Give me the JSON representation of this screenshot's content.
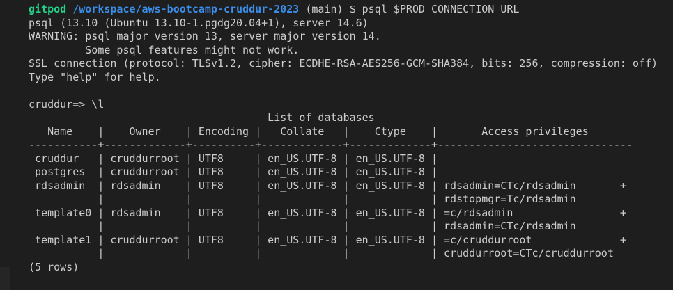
{
  "terminal": {
    "prompt": {
      "user": "gitpod",
      "path": "/workspace/aws-bootcamp-cruddur-2023",
      "branch": "(main)",
      "symbol": "$",
      "command": "psql $PROD_CONNECTION_URL"
    },
    "output_lines": [
      "psql (13.10 (Ubuntu 13.10-1.pgdg20.04+1), server 14.6)",
      "WARNING: psql major version 13, server major version 14.",
      "         Some psql features might not work.",
      "SSL connection (protocol: TLSv1.2, cipher: ECDHE-RSA-AES256-GCM-SHA384, bits: 256, compression: off)",
      "Type \"help\" for help.",
      "",
      "cruddur=> \\l",
      "                                      List of databases",
      "   Name    |    Owner    | Encoding |   Collate   |    Ctype    |       Access privileges",
      "-----------+-------------+----------+-------------+-------------+-------------------------------",
      " cruddur   | cruddurroot | UTF8     | en_US.UTF-8 | en_US.UTF-8 | ",
      " postgres  | cruddurroot | UTF8     | en_US.UTF-8 | en_US.UTF-8 | ",
      " rdsadmin  | rdsadmin    | UTF8     | en_US.UTF-8 | en_US.UTF-8 | rdsadmin=CTc/rdsadmin       +",
      "           |             |          |             |             | rdstopmgr=Tc/rdsadmin",
      " template0 | rdsadmin    | UTF8     | en_US.UTF-8 | en_US.UTF-8 | =c/rdsadmin                 +",
      "           |             |          |             |             | rdsadmin=CTc/rdsadmin",
      " template1 | cruddurroot | UTF8     | en_US.UTF-8 | en_US.UTF-8 | =c/cruddurroot              +",
      "           |             |          |             |             | cruddurroot=CTc/cruddurroot",
      "(5 rows)"
    ]
  },
  "colors": {
    "background": "#1e1e1e",
    "text": "#cccccc",
    "prompt_user": "#23d18b",
    "prompt_path": "#3b8eea"
  }
}
